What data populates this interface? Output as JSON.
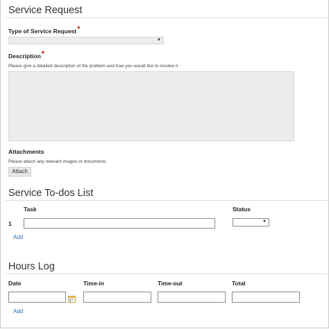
{
  "service_request": {
    "title": "Service Request",
    "type_label": "Type of Service Request",
    "type_value": "",
    "description_label": "Description",
    "description_hint": "Please give a detailed description of the problem and how you would like to resolve it",
    "description_value": "",
    "required_mark": "*",
    "attachments_label": "Attachments",
    "attachments_hint": "Please attach any relevant images or documents",
    "attach_button": "Attach"
  },
  "todos": {
    "title": "Service To-dos List",
    "columns": {
      "task": "Task",
      "status": "Status"
    },
    "rows": [
      {
        "number": "1",
        "task": "",
        "status": ""
      }
    ],
    "add_link": "Add"
  },
  "hours": {
    "title": "Hours Log",
    "columns": {
      "date": "Date",
      "time_in": "Time-in",
      "time_out": "Time-out",
      "total": "Total"
    },
    "rows": [
      {
        "date": "",
        "time_in": "",
        "time_out": "",
        "total": ""
      }
    ],
    "add_link": "Add"
  },
  "icons": {
    "calendar": "calendar-icon",
    "dropdown": "chevron-down-icon"
  },
  "colors": {
    "link": "#2a6fb7",
    "required": "#b5211b",
    "field_bg": "#ececec"
  }
}
